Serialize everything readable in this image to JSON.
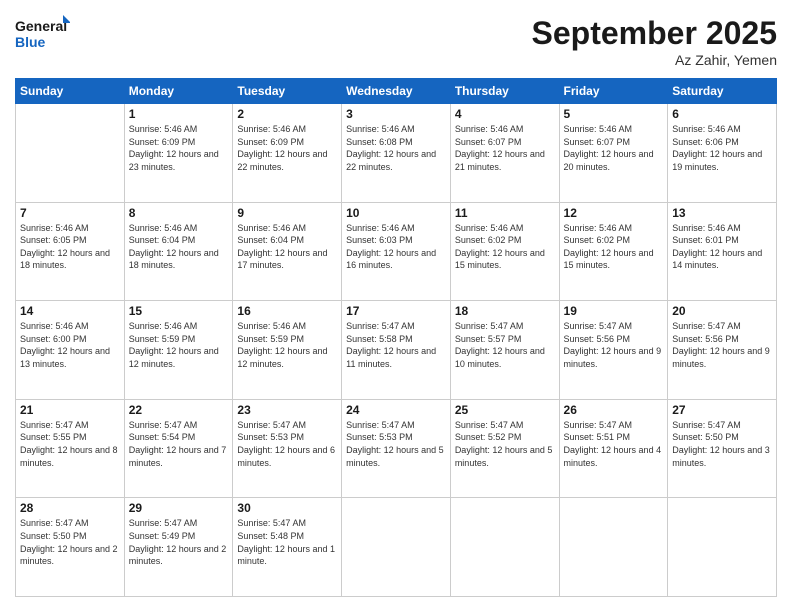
{
  "logo": {
    "line1": "General",
    "line2": "Blue"
  },
  "title": "September 2025",
  "location": "Az Zahir, Yemen",
  "days_header": [
    "Sunday",
    "Monday",
    "Tuesday",
    "Wednesday",
    "Thursday",
    "Friday",
    "Saturday"
  ],
  "weeks": [
    [
      null,
      {
        "day": "1",
        "sunrise": "5:46 AM",
        "sunset": "6:09 PM",
        "daylight": "12 hours and 23 minutes."
      },
      {
        "day": "2",
        "sunrise": "5:46 AM",
        "sunset": "6:09 PM",
        "daylight": "12 hours and 22 minutes."
      },
      {
        "day": "3",
        "sunrise": "5:46 AM",
        "sunset": "6:08 PM",
        "daylight": "12 hours and 22 minutes."
      },
      {
        "day": "4",
        "sunrise": "5:46 AM",
        "sunset": "6:07 PM",
        "daylight": "12 hours and 21 minutes."
      },
      {
        "day": "5",
        "sunrise": "5:46 AM",
        "sunset": "6:07 PM",
        "daylight": "12 hours and 20 minutes."
      },
      {
        "day": "6",
        "sunrise": "5:46 AM",
        "sunset": "6:06 PM",
        "daylight": "12 hours and 19 minutes."
      }
    ],
    [
      {
        "day": "7",
        "sunrise": "5:46 AM",
        "sunset": "6:05 PM",
        "daylight": "12 hours and 18 minutes."
      },
      {
        "day": "8",
        "sunrise": "5:46 AM",
        "sunset": "6:04 PM",
        "daylight": "12 hours and 18 minutes."
      },
      {
        "day": "9",
        "sunrise": "5:46 AM",
        "sunset": "6:04 PM",
        "daylight": "12 hours and 17 minutes."
      },
      {
        "day": "10",
        "sunrise": "5:46 AM",
        "sunset": "6:03 PM",
        "daylight": "12 hours and 16 minutes."
      },
      {
        "day": "11",
        "sunrise": "5:46 AM",
        "sunset": "6:02 PM",
        "daylight": "12 hours and 15 minutes."
      },
      {
        "day": "12",
        "sunrise": "5:46 AM",
        "sunset": "6:02 PM",
        "daylight": "12 hours and 15 minutes."
      },
      {
        "day": "13",
        "sunrise": "5:46 AM",
        "sunset": "6:01 PM",
        "daylight": "12 hours and 14 minutes."
      }
    ],
    [
      {
        "day": "14",
        "sunrise": "5:46 AM",
        "sunset": "6:00 PM",
        "daylight": "12 hours and 13 minutes."
      },
      {
        "day": "15",
        "sunrise": "5:46 AM",
        "sunset": "5:59 PM",
        "daylight": "12 hours and 12 minutes."
      },
      {
        "day": "16",
        "sunrise": "5:46 AM",
        "sunset": "5:59 PM",
        "daylight": "12 hours and 12 minutes."
      },
      {
        "day": "17",
        "sunrise": "5:47 AM",
        "sunset": "5:58 PM",
        "daylight": "12 hours and 11 minutes."
      },
      {
        "day": "18",
        "sunrise": "5:47 AM",
        "sunset": "5:57 PM",
        "daylight": "12 hours and 10 minutes."
      },
      {
        "day": "19",
        "sunrise": "5:47 AM",
        "sunset": "5:56 PM",
        "daylight": "12 hours and 9 minutes."
      },
      {
        "day": "20",
        "sunrise": "5:47 AM",
        "sunset": "5:56 PM",
        "daylight": "12 hours and 9 minutes."
      }
    ],
    [
      {
        "day": "21",
        "sunrise": "5:47 AM",
        "sunset": "5:55 PM",
        "daylight": "12 hours and 8 minutes."
      },
      {
        "day": "22",
        "sunrise": "5:47 AM",
        "sunset": "5:54 PM",
        "daylight": "12 hours and 7 minutes."
      },
      {
        "day": "23",
        "sunrise": "5:47 AM",
        "sunset": "5:53 PM",
        "daylight": "12 hours and 6 minutes."
      },
      {
        "day": "24",
        "sunrise": "5:47 AM",
        "sunset": "5:53 PM",
        "daylight": "12 hours and 5 minutes."
      },
      {
        "day": "25",
        "sunrise": "5:47 AM",
        "sunset": "5:52 PM",
        "daylight": "12 hours and 5 minutes."
      },
      {
        "day": "26",
        "sunrise": "5:47 AM",
        "sunset": "5:51 PM",
        "daylight": "12 hours and 4 minutes."
      },
      {
        "day": "27",
        "sunrise": "5:47 AM",
        "sunset": "5:50 PM",
        "daylight": "12 hours and 3 minutes."
      }
    ],
    [
      {
        "day": "28",
        "sunrise": "5:47 AM",
        "sunset": "5:50 PM",
        "daylight": "12 hours and 2 minutes."
      },
      {
        "day": "29",
        "sunrise": "5:47 AM",
        "sunset": "5:49 PM",
        "daylight": "12 hours and 2 minutes."
      },
      {
        "day": "30",
        "sunrise": "5:47 AM",
        "sunset": "5:48 PM",
        "daylight": "12 hours and 1 minute."
      },
      null,
      null,
      null,
      null
    ]
  ]
}
